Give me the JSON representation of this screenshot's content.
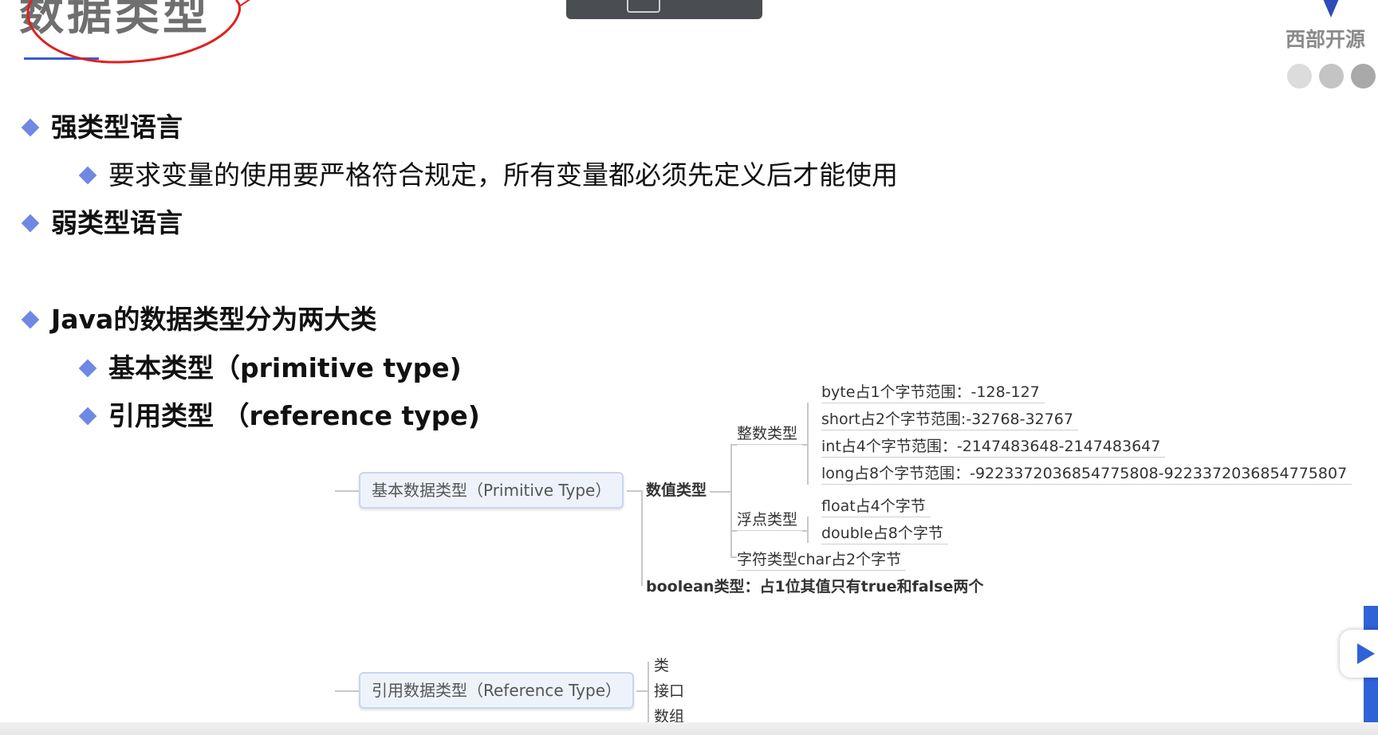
{
  "title": "数据类型",
  "logo": {
    "text": "西部开源"
  },
  "colors": {
    "bullet": "#6f88e3",
    "accent": "#2e62d8",
    "circle": "#e02020",
    "node_border": "#c9d6ee",
    "node_bg": "#eef3fb"
  },
  "bullets": {
    "strong": "强类型语言",
    "strong_desc": "要求变量的使用要严格符合规定，所有变量都必须先定义后才能使用",
    "weak": "弱类型语言",
    "java": "Java的数据类型分为两大类",
    "primitive": "基本类型（primitive type)",
    "reference": "引用类型 （reference type)"
  },
  "mindmap": {
    "primitive_root": "基本数据类型（Primitive Type）",
    "numeric": "数值类型",
    "integer": "整数类型",
    "byte": "byte占1个字节范围：-128-127",
    "short": "short占2个字节范围:-32768-32767",
    "int": "int占4个字节范围：-2147483648-2147483647",
    "long": "long占8个字节范围：-9223372036854775808-9223372036854775807",
    "float_group": "浮点类型",
    "float": "float占4个字节",
    "double": "double占8个字节",
    "char": "字符类型char占2个字节",
    "boolean": "boolean类型：占1位其值只有true和false两个",
    "reference_root": "引用数据类型（Reference Type）",
    "class": "类",
    "interface": "接口",
    "array": "数组"
  },
  "icons": [
    "diamond-bullet-icon",
    "play-icon",
    "logo-mark-icon",
    "red-circle-annotation"
  ]
}
